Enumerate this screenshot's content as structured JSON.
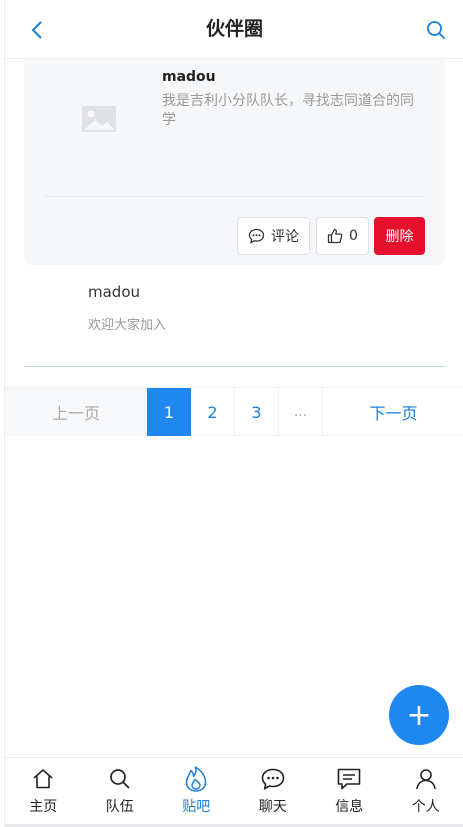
{
  "header": {
    "title": "伙伴圈"
  },
  "post1": {
    "username": "madou",
    "content": "我是吉利小分队队长，寻找志同道合的同学",
    "comment_label": "评论",
    "like_count": "0",
    "delete_label": "删除"
  },
  "post2": {
    "username": "madou",
    "content": "欢迎大家加入"
  },
  "pager": {
    "prev": "上一页",
    "pages": [
      "1",
      "2",
      "3"
    ],
    "dots": "...",
    "next": "下一页"
  },
  "fab": {
    "symbol": "+"
  },
  "tabs": [
    {
      "label": "主页",
      "icon": "home-icon"
    },
    {
      "label": "队伍",
      "icon": "search-icon"
    },
    {
      "label": "贴吧",
      "icon": "flame-icon"
    },
    {
      "label": "聊天",
      "icon": "chat-bubble-icon"
    },
    {
      "label": "信息",
      "icon": "message-icon"
    },
    {
      "label": "个人",
      "icon": "user-icon"
    }
  ],
  "colors": {
    "accent": "#1e88f0",
    "danger": "#e6102c",
    "muted": "#999999"
  }
}
